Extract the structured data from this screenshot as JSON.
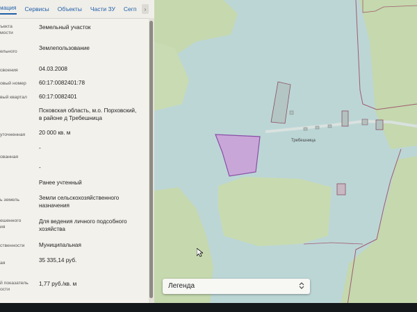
{
  "tabs": [
    {
      "label": "рмация",
      "active": true
    },
    {
      "label": "Сервисы",
      "active": false
    },
    {
      "label": "Объекты",
      "active": false
    },
    {
      "label": "Части ЗУ",
      "active": false
    },
    {
      "label": "Сегп",
      "active": false
    }
  ],
  "tabs_more_icon": "chevron-right-icon",
  "rows": [
    {
      "label": "ъекта\nмости",
      "value": "Земельный участок"
    },
    {
      "label": "ельного",
      "value": "Землепользование"
    },
    {
      "label": "своения",
      "value": "04.03.2008"
    },
    {
      "label": "овый номер",
      "value": "60:17:0082401:78"
    },
    {
      "label": "вый квартал",
      "value": "60:17:0082401"
    },
    {
      "label": "",
      "value": "Псковская область, м.о. Порховский,\nв районе д Требешница"
    },
    {
      "label": "уточненная",
      "value": "20 000 кв. м"
    },
    {
      "label": "",
      "value": "-"
    },
    {
      "label": "ованная",
      "value": ""
    },
    {
      "label": "",
      "value": "-"
    },
    {
      "label": "",
      "value": "Ранее учтенный"
    },
    {
      "label": "ь земель",
      "value": "Земли сельскохозяйственного\nназначения"
    },
    {
      "label": "ешенного\nия",
      "value": "Для ведения личного подсобного\nхозяйства"
    },
    {
      "label": "ственности",
      "value": "Муниципальная"
    },
    {
      "label": "ая",
      "value": "35 335,14 руб."
    },
    {
      "label": "й показатель\nости",
      "value": "1,77 руб./кв. м"
    }
  ],
  "map": {
    "settlement_label": "Требешница",
    "legend_label": "Легенда",
    "legend_icon": "up-down-chevron-icon",
    "colors": {
      "background": "#bcd6d6",
      "agricultural": "#c5d8ae",
      "selected_parcel_fill": "#c9a6d8",
      "selected_parcel_stroke": "#8a4ea6",
      "boundary": "#a05a6e"
    }
  }
}
